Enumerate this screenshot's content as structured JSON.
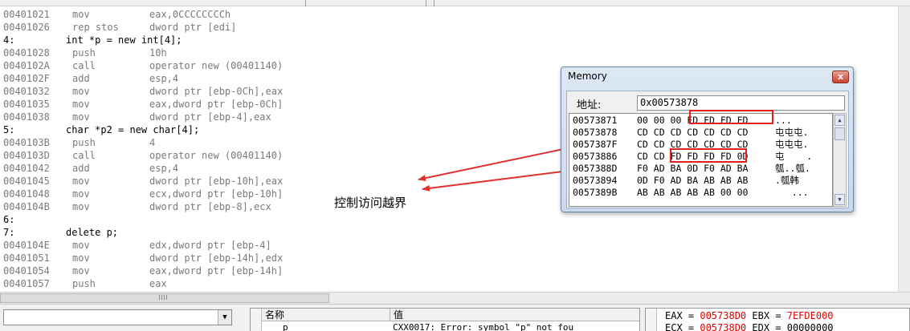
{
  "disassembly": [
    {
      "addr": "00401021",
      "op": "mov",
      "args": "eax,0CCCCCCCCh"
    },
    {
      "addr": "00401026",
      "op": "rep stos",
      "args": "dword ptr [edi]"
    },
    {
      "src_no": "4:",
      "src_text": "int *p = new int[4];"
    },
    {
      "addr": "00401028",
      "op": "push",
      "args": "10h"
    },
    {
      "addr": "0040102A",
      "op": "call",
      "args": "operator new (00401140)"
    },
    {
      "addr": "0040102F",
      "op": "add",
      "args": "esp,4"
    },
    {
      "addr": "00401032",
      "op": "mov",
      "args": "dword ptr [ebp-0Ch],eax"
    },
    {
      "addr": "00401035",
      "op": "mov",
      "args": "eax,dword ptr [ebp-0Ch]"
    },
    {
      "addr": "00401038",
      "op": "mov",
      "args": "dword ptr [ebp-4],eax"
    },
    {
      "src_no": "5:",
      "src_text": "char *p2 = new char[4];"
    },
    {
      "addr": "0040103B",
      "op": "push",
      "args": "4"
    },
    {
      "addr": "0040103D",
      "op": "call",
      "args": "operator new (00401140)"
    },
    {
      "addr": "00401042",
      "op": "add",
      "args": "esp,4"
    },
    {
      "addr": "00401045",
      "op": "mov",
      "args": "dword ptr [ebp-10h],eax"
    },
    {
      "addr": "00401048",
      "op": "mov",
      "args": "ecx,dword ptr [ebp-10h]"
    },
    {
      "addr": "0040104B",
      "op": "mov",
      "args": "dword ptr [ebp-8],ecx"
    },
    {
      "src_no": "6:",
      "src_text": ""
    },
    {
      "src_no": "7:",
      "src_text": "delete p;"
    },
    {
      "addr": "0040104E",
      "op": "mov",
      "args": "edx,dword ptr [ebp-4]"
    },
    {
      "addr": "00401051",
      "op": "mov",
      "args": "dword ptr [ebp-14h],edx"
    },
    {
      "addr": "00401054",
      "op": "mov",
      "args": "eax,dword ptr [ebp-14h]"
    },
    {
      "addr": "00401057",
      "op": "push",
      "args": "eax"
    }
  ],
  "annotation": "控制访问越界",
  "memory_window": {
    "title": "Memory",
    "close_label": "x",
    "address_label": "地址:",
    "address_value": "0x00573878",
    "rows": [
      {
        "addr": "00573871",
        "bytes": "00 00 00 FD FD FD FD",
        "chars": "..."
      },
      {
        "addr": "00573878",
        "bytes": "CD CD CD CD CD CD CD",
        "chars": "屯屯屯."
      },
      {
        "addr": "0057387F",
        "bytes": "CD CD CD CD CD CD CD",
        "chars": "屯屯屯."
      },
      {
        "addr": "00573886",
        "bytes": "CD CD FD FD FD FD 0D",
        "chars": "屯    ."
      },
      {
        "addr": "0057388D",
        "bytes": "F0 AD BA 0D F0 AD BA",
        "chars": "瓠..瓠."
      },
      {
        "addr": "00573894",
        "bytes": "0D F0 AD BA AB AB AB",
        "chars": ".瓠韩"
      },
      {
        "addr": "0057389B",
        "bytes": "AB AB AB AB AB 00 00",
        "chars": "   ..."
      }
    ],
    "scroll_up_icon": "▲",
    "scroll_down_icon": "▼"
  },
  "watch": {
    "col_name": "名称",
    "col_value": "值",
    "row_name": "p",
    "row_value": "CXX0017: Error: symbol \"p\" not fou"
  },
  "registers": {
    "eax_label": "EAX = ",
    "eax_value": "005738D0",
    "ebx_label": " EBX = ",
    "ebx_value": "7EFDE000",
    "ecx_label": "ECX = ",
    "ecx_value": "005738D0",
    "edx_label": " EDX = ",
    "edx_value": "00000000"
  },
  "combo_arrow": "▼",
  "colors": {
    "highlight": "#e02020",
    "register_changed": "#e00000",
    "arrow": "#e03030"
  }
}
